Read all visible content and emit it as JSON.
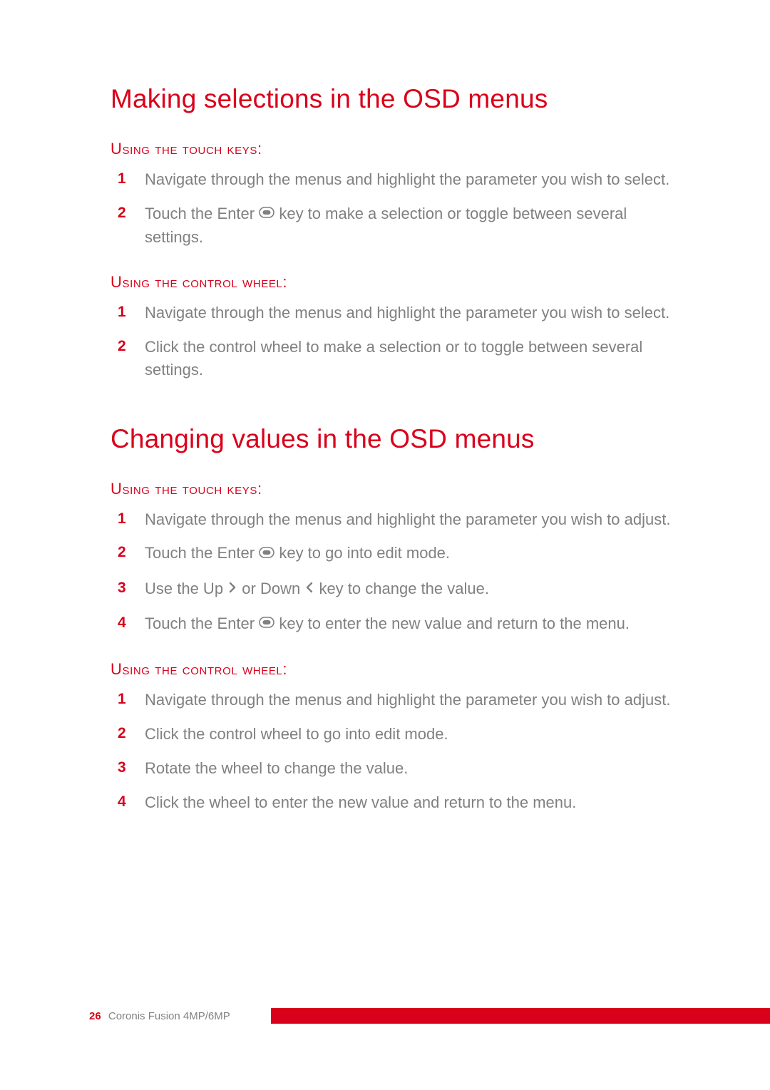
{
  "heading1": "Making selections in the OSD menus",
  "section1": {
    "subhead": "Using the touch keys:",
    "steps": [
      {
        "n": "1",
        "before": "Navigate through the menus and highlight the parameter you wish to select.",
        "icon": null,
        "after": ""
      },
      {
        "n": "2",
        "before": "Touch the Enter ",
        "icon": "enter",
        "after": " key to make a selection or toggle between several settings."
      }
    ]
  },
  "section2": {
    "subhead": "Using the control wheel:",
    "steps": [
      {
        "n": "1",
        "before": "Navigate through the menus and highlight the parameter you wish to select.",
        "icon": null,
        "after": ""
      },
      {
        "n": "2",
        "before": "Click the control wheel to make a selection or to toggle between several settings.",
        "icon": null,
        "after": ""
      }
    ]
  },
  "heading2": "Changing values in the OSD menus",
  "section3": {
    "subhead": "Using the touch keys:",
    "steps": [
      {
        "n": "1",
        "before": "Navigate through the menus and highlight the parameter you wish to adjust.",
        "icon": null,
        "after": ""
      },
      {
        "n": "2",
        "before": "Touch the Enter ",
        "icon": "enter",
        "after": " key to go into edit mode."
      },
      {
        "n": "3",
        "before": "Use the Up ",
        "icon": "up",
        "mid": " or Down ",
        "icon2": "down",
        "after": " key to change the value."
      },
      {
        "n": "4",
        "before": "Touch the Enter ",
        "icon": "enter",
        "after": " key to enter the new value and return to the menu."
      }
    ]
  },
  "section4": {
    "subhead": "Using the control wheel:",
    "steps": [
      {
        "n": "1",
        "before": "Navigate through the menus and highlight the parameter you wish to adjust.",
        "icon": null,
        "after": ""
      },
      {
        "n": "2",
        "before": "Click the control wheel to go into edit mode.",
        "icon": null,
        "after": ""
      },
      {
        "n": "3",
        "before": "Rotate the wheel to change the value.",
        "icon": null,
        "after": ""
      },
      {
        "n": "4",
        "before": "Click the wheel to enter the new value and return to the menu.",
        "icon": null,
        "after": ""
      }
    ]
  },
  "footer": {
    "page": "26",
    "title": "Coronis Fusion 4MP/6MP"
  }
}
